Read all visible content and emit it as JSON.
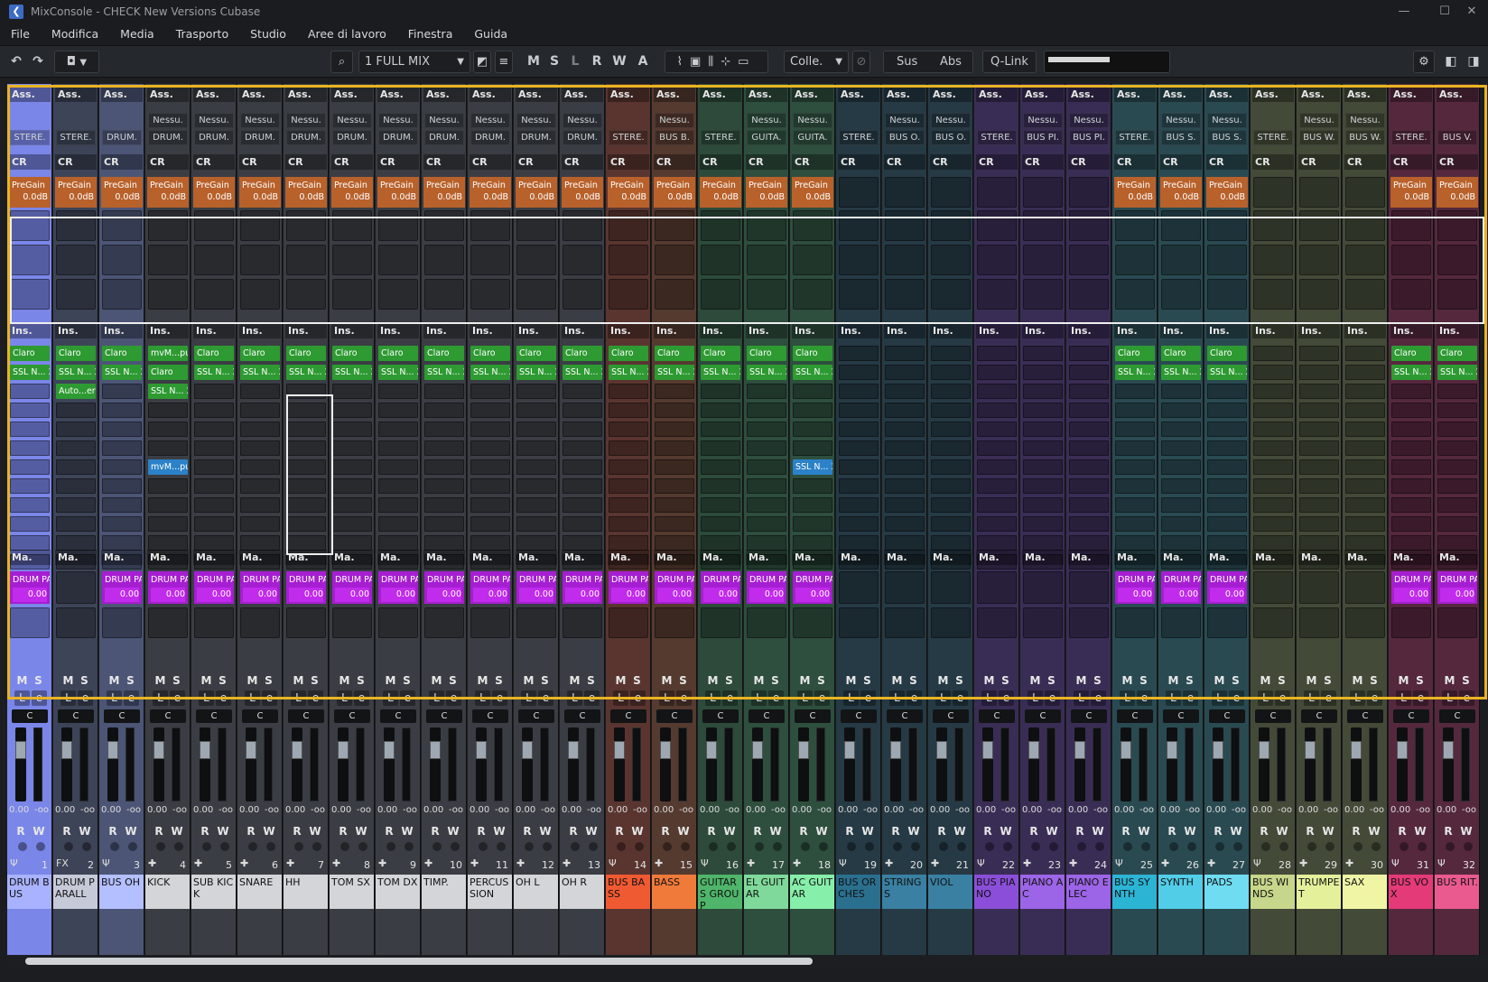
{
  "window": {
    "title": "MixConsole - CHECK New Versions Cubase",
    "minimize": "—",
    "maximize": "☐",
    "close": "✕"
  },
  "menu": [
    "File",
    "Modifica",
    "Media",
    "Trasporto",
    "Studio",
    "Aree di lavoro",
    "Finestra",
    "Guida"
  ],
  "toolbar": {
    "undo": "↶",
    "redo": "↷",
    "snapshot": "◘",
    "dropdown": "▼",
    "search": "⌕",
    "config": "1 FULL MIX",
    "config_arrow": "▼",
    "m": "M",
    "s": "S",
    "l": "L",
    "r": "R",
    "w": "W",
    "a": "A",
    "link_label": "Colle.",
    "link_arrow": "▼",
    "sus": "Sus",
    "abs": "Abs",
    "qlink": "Q-Link",
    "settings": "⚙"
  },
  "labels": {
    "ass": "Ass.",
    "cr": "CR",
    "pregain": "PreGain",
    "pregain_val": "0.0dB",
    "ins": "Ins.",
    "ma": "Ma.",
    "send_name": "DRUM PA",
    "send_val": "0.00",
    "nessu": "Nessu.",
    "mute": "M",
    "solo": "S",
    "listen": "L",
    "edit": "e",
    "pan": "C",
    "read": "R",
    "write": "W",
    "fader_val": "0.00",
    "meter_val": "-oo",
    "claro": "Claro",
    "ssl": "SSL N... 2",
    "mvm": "mvM...pu",
    "auto": "Auto...er"
  },
  "channels": [
    {
      "num": "1",
      "name": "DRUM BUS",
      "color": "#7a86e8",
      "nm": "#a9b2ff",
      "in": "",
      "out": "STERE.",
      "pg": true,
      "ins": [
        "claro",
        "ssl",
        "",
        "",
        "",
        "",
        "",
        "",
        "",
        "",
        "",
        ""
      ],
      "send": true,
      "icon": "Ψ"
    },
    {
      "num": "2",
      "name": "DRUM PARALL",
      "color": "#3e4457",
      "nm": "#c6cad8",
      "in": "",
      "out": "STERE.",
      "pg": true,
      "ins": [
        "claro",
        "ssl",
        "auto",
        "",
        "",
        "",
        "",
        "",
        "",
        "",
        "",
        ""
      ],
      "send": false,
      "icon": "FX"
    },
    {
      "num": "3",
      "name": "BUS OH",
      "color": "#4c5575",
      "nm": "#b4bfff",
      "in": "",
      "out": "DRUM.",
      "pg": true,
      "ins": [
        "claro",
        "ssl",
        "",
        "",
        "",
        "",
        "",
        "",
        "",
        "",
        "",
        ""
      ],
      "send": true,
      "icon": "Ψ"
    },
    {
      "num": "4",
      "name": "KICK",
      "color": "#3a3d43",
      "nm": "#d3d5d8",
      "in": "Nessu.",
      "out": "DRUM.",
      "pg": true,
      "ins": [
        "mvm",
        "claro",
        "ssl",
        "",
        "",
        "",
        "mvmb",
        "",
        "",
        "",
        "",
        ""
      ],
      "send": true,
      "icon": "✚"
    },
    {
      "num": "5",
      "name": "SUB KICK",
      "color": "#3a3d43",
      "nm": "#d3d5d8",
      "in": "Nessu.",
      "out": "DRUM.",
      "pg": true,
      "ins": [
        "claro",
        "ssl",
        "",
        "",
        "",
        "",
        "",
        "",
        "",
        "",
        "",
        ""
      ],
      "send": true,
      "icon": "✚"
    },
    {
      "num": "6",
      "name": "SNARE",
      "color": "#3a3d43",
      "nm": "#d3d5d8",
      "in": "Nessu.",
      "out": "DRUM.",
      "pg": true,
      "ins": [
        "claro",
        "ssl",
        "",
        "",
        "",
        "",
        "",
        "",
        "",
        "",
        "",
        ""
      ],
      "send": true,
      "icon": "✚"
    },
    {
      "num": "7",
      "name": "HH",
      "color": "#3a3d43",
      "nm": "#d3d5d8",
      "in": "Nessu.",
      "out": "DRUM.",
      "pg": true,
      "ins": [
        "claro",
        "ssl",
        "",
        "",
        "",
        "",
        "",
        "",
        "",
        "",
        "",
        ""
      ],
      "send": true,
      "icon": "✚"
    },
    {
      "num": "8",
      "name": "TOM SX",
      "color": "#3a3d43",
      "nm": "#d3d5d8",
      "in": "Nessu.",
      "out": "DRUM.",
      "pg": true,
      "ins": [
        "claro",
        "ssl",
        "",
        "",
        "",
        "",
        "",
        "",
        "",
        "",
        "",
        ""
      ],
      "send": true,
      "icon": "✚"
    },
    {
      "num": "9",
      "name": "TOM DX",
      "color": "#3a3d43",
      "nm": "#d3d5d8",
      "in": "Nessu.",
      "out": "DRUM.",
      "pg": true,
      "ins": [
        "claro",
        "ssl",
        "",
        "",
        "",
        "",
        "",
        "",
        "",
        "",
        "",
        ""
      ],
      "send": true,
      "icon": "✚"
    },
    {
      "num": "10",
      "name": "TIMP.",
      "color": "#3a3d43",
      "nm": "#d3d5d8",
      "in": "Nessu.",
      "out": "DRUM.",
      "pg": true,
      "ins": [
        "claro",
        "ssl",
        "",
        "",
        "",
        "",
        "",
        "",
        "",
        "",
        "",
        ""
      ],
      "send": true,
      "icon": "✚"
    },
    {
      "num": "11",
      "name": "PERCUSSION",
      "color": "#3a3d43",
      "nm": "#d3d5d8",
      "in": "Nessu.",
      "out": "DRUM.",
      "pg": true,
      "ins": [
        "claro",
        "ssl",
        "",
        "",
        "",
        "",
        "",
        "",
        "",
        "",
        "",
        ""
      ],
      "send": true,
      "icon": "✚"
    },
    {
      "num": "12",
      "name": "OH L",
      "color": "#3a3d43",
      "nm": "#d3d5d8",
      "in": "Nessu.",
      "out": "DRUM.",
      "pg": true,
      "ins": [
        "claro",
        "ssl",
        "",
        "",
        "",
        "",
        "",
        "",
        "",
        "",
        "",
        ""
      ],
      "send": true,
      "icon": "✚"
    },
    {
      "num": "13",
      "name": "OH R",
      "color": "#3a3d43",
      "nm": "#d3d5d8",
      "in": "Nessu.",
      "out": "DRUM.",
      "pg": true,
      "ins": [
        "claro",
        "ssl",
        "",
        "",
        "",
        "",
        "",
        "",
        "",
        "",
        "",
        ""
      ],
      "send": true,
      "icon": "✚"
    },
    {
      "num": "14",
      "name": "BUS BASS",
      "color": "#5a3530",
      "nm": "#f05a32",
      "in": "",
      "out": "STERE.",
      "pg": true,
      "ins": [
        "claro",
        "ssl",
        "",
        "",
        "",
        "",
        "",
        "",
        "",
        "",
        "",
        ""
      ],
      "send": true,
      "icon": "Ψ"
    },
    {
      "num": "15",
      "name": "BASS",
      "color": "#553a30",
      "nm": "#f07a3a",
      "in": "Nessu.",
      "out": "BUS B.",
      "pg": true,
      "ins": [
        "claro",
        "ssl",
        "",
        "",
        "",
        "",
        "",
        "",
        "",
        "",
        "",
        ""
      ],
      "send": true,
      "icon": "✚"
    },
    {
      "num": "16",
      "name": "GUITARS GROUP",
      "color": "#2d4a3a",
      "nm": "#4fb56a",
      "in": "",
      "out": "STERE.",
      "pg": true,
      "ins": [
        "claro",
        "ssl",
        "",
        "",
        "",
        "",
        "",
        "",
        "",
        "",
        "",
        ""
      ],
      "send": true,
      "icon": "Ψ"
    },
    {
      "num": "17",
      "name": "EL GUITAR",
      "color": "#2e4e3e",
      "nm": "#7ed99a",
      "in": "Nessu.",
      "out": "GUITA.",
      "pg": true,
      "ins": [
        "claro",
        "ssl",
        "",
        "",
        "",
        "",
        "",
        "",
        "",
        "",
        "",
        ""
      ],
      "send": true,
      "icon": "✚"
    },
    {
      "num": "18",
      "name": "AC GUITAR",
      "color": "#2e4e3e",
      "nm": "#86efaa",
      "in": "Nessu.",
      "out": "GUITA.",
      "pg": true,
      "ins": [
        "claro",
        "ssl",
        "",
        "",
        "",
        "",
        "sslb",
        "",
        "",
        "",
        "",
        ""
      ],
      "send": true,
      "icon": "✚"
    },
    {
      "num": "19",
      "name": "BUS ORCHES",
      "color": "#263a45",
      "nm": "#2b6f8e",
      "in": "",
      "out": "STERE.",
      "pg": false,
      "ins": [
        "",
        "",
        "",
        "",
        "",
        "",
        "",
        "",
        "",
        "",
        "",
        ""
      ],
      "send": false,
      "icon": "Ψ"
    },
    {
      "num": "20",
      "name": "STRINGS",
      "color": "#263a45",
      "nm": "#3a80a2",
      "in": "Nessu.",
      "out": "BUS O.",
      "pg": false,
      "ins": [
        "",
        "",
        "",
        "",
        "",
        "",
        "",
        "",
        "",
        "",
        "",
        ""
      ],
      "send": false,
      "icon": "✚"
    },
    {
      "num": "21",
      "name": "VIOL",
      "color": "#263a45",
      "nm": "#3a80a2",
      "in": "Nessu.",
      "out": "BUS O.",
      "pg": false,
      "ins": [
        "",
        "",
        "",
        "",
        "",
        "",
        "",
        "",
        "",
        "",
        "",
        ""
      ],
      "send": false,
      "icon": "✚"
    },
    {
      "num": "22",
      "name": "BUS PIANO",
      "color": "#3a2d55",
      "nm": "#8a4ed8",
      "in": "",
      "out": "STERE.",
      "pg": false,
      "ins": [
        "",
        "",
        "",
        "",
        "",
        "",
        "",
        "",
        "",
        "",
        "",
        ""
      ],
      "send": false,
      "icon": "Ψ"
    },
    {
      "num": "23",
      "name": "PIANO AC",
      "color": "#3a2d55",
      "nm": "#9c64e6",
      "in": "Nessu.",
      "out": "BUS PI.",
      "pg": false,
      "ins": [
        "",
        "",
        "",
        "",
        "",
        "",
        "",
        "",
        "",
        "",
        "",
        ""
      ],
      "send": false,
      "icon": "✚"
    },
    {
      "num": "24",
      "name": "PIANO ELEC",
      "color": "#3a2d55",
      "nm": "#9c64e6",
      "in": "Nessu.",
      "out": "BUS PI.",
      "pg": false,
      "ins": [
        "",
        "",
        "",
        "",
        "",
        "",
        "",
        "",
        "",
        "",
        "",
        ""
      ],
      "send": false,
      "icon": "✚"
    },
    {
      "num": "25",
      "name": "BUS SYNTH",
      "color": "#2a4a52",
      "nm": "#2cb4d4",
      "in": "",
      "out": "STERE.",
      "pg": true,
      "ins": [
        "claro",
        "ssl",
        "",
        "",
        "",
        "",
        "",
        "",
        "",
        "",
        "",
        ""
      ],
      "send": true,
      "icon": "Ψ"
    },
    {
      "num": "26",
      "name": "SYNTH",
      "color": "#2a4a52",
      "nm": "#52cde8",
      "in": "Nessu.",
      "out": "BUS S.",
      "pg": true,
      "ins": [
        "claro",
        "ssl",
        "",
        "",
        "",
        "",
        "",
        "",
        "",
        "",
        "",
        ""
      ],
      "send": true,
      "icon": "✚"
    },
    {
      "num": "27",
      "name": "PADS",
      "color": "#2a4a52",
      "nm": "#6fdcf2",
      "in": "Nessu.",
      "out": "BUS S.",
      "pg": true,
      "ins": [
        "claro",
        "ssl",
        "",
        "",
        "",
        "",
        "",
        "",
        "",
        "",
        "",
        ""
      ],
      "send": true,
      "icon": "✚"
    },
    {
      "num": "28",
      "name": "BUS WINDS",
      "color": "#434a38",
      "nm": "#c6d68a",
      "in": "",
      "out": "STERE.",
      "pg": false,
      "ins": [
        "",
        "",
        "",
        "",
        "",
        "",
        "",
        "",
        "",
        "",
        "",
        ""
      ],
      "send": false,
      "icon": "Ψ"
    },
    {
      "num": "29",
      "name": "TRUMPET",
      "color": "#434a38",
      "nm": "#e5f09a",
      "in": "Nessu.",
      "out": "BUS W.",
      "pg": false,
      "ins": [
        "",
        "",
        "",
        "",
        "",
        "",
        "",
        "",
        "",
        "",
        "",
        ""
      ],
      "send": false,
      "icon": "✚"
    },
    {
      "num": "30",
      "name": "SAX",
      "color": "#434a38",
      "nm": "#f0f5a5",
      "in": "Nessu.",
      "out": "BUS W.",
      "pg": false,
      "ins": [
        "",
        "",
        "",
        "",
        "",
        "",
        "",
        "",
        "",
        "",
        "",
        ""
      ],
      "send": false,
      "icon": "✚"
    },
    {
      "num": "31",
      "name": "BUS VOX",
      "color": "#55283e",
      "nm": "#e43a78",
      "in": "",
      "out": "STERE.",
      "pg": true,
      "ins": [
        "claro",
        "ssl",
        "",
        "",
        "",
        "",
        "",
        "",
        "",
        "",
        "",
        ""
      ],
      "send": true,
      "icon": "Ψ"
    },
    {
      "num": "32",
      "name": "BUS RIT.",
      "color": "#55283e",
      "nm": "#ea5a8e",
      "in": "",
      "out": "BUS V.",
      "pg": true,
      "ins": [
        "claro",
        "ssl",
        "",
        "",
        "",
        "",
        "",
        "",
        "",
        "",
        "",
        ""
      ],
      "send": true,
      "icon": "Ψ"
    }
  ]
}
